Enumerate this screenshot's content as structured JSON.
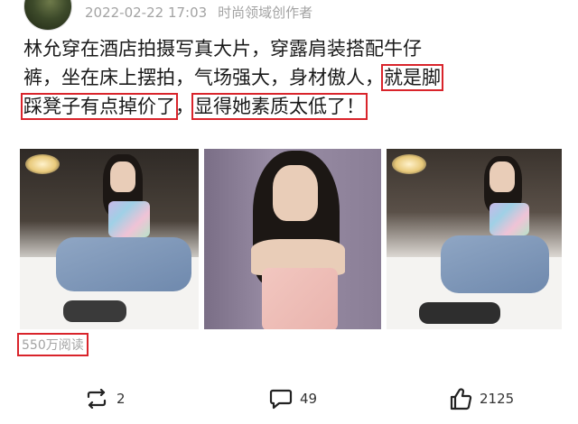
{
  "post_meta": {
    "date": "2022-02-22 17:03",
    "author_tag": "时尚领域创作者"
  },
  "post_text": {
    "line1": "林允穿在酒店拍摄写真大片，穿露肩装搭配牛仔",
    "line2_a": "裤，坐在床上摆拍，气场强大，身材傲人，",
    "line2_highlight": "就是脚",
    "line3_highlight_a": "踩凳子有点掉价了",
    "line3_comma": "，",
    "line3_highlight_b": "显得她素质太低了！"
  },
  "read_count": "550万阅读",
  "actions": {
    "repost_count": "2",
    "comment_count": "49",
    "like_count": "2125"
  },
  "colors": {
    "highlight_box": "#d9242b",
    "meta_gray": "#a3a3a3"
  },
  "icons": [
    "repost-icon",
    "comment-icon",
    "like-icon"
  ]
}
